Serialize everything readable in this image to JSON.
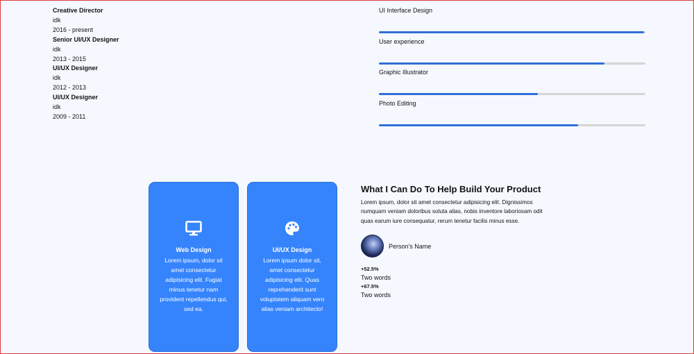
{
  "experience": [
    {
      "role": "Creative Director",
      "company": "idk",
      "period": "2016 - present"
    },
    {
      "role": "Senior UI/UX Designer",
      "company": "idk",
      "period": "2013 - 2015"
    },
    {
      "role": "UI/UX Designer",
      "company": "idk",
      "period": "2012 - 2013"
    },
    {
      "role": "UI/UX Designer",
      "company": "idk",
      "period": "2009 - 2011"
    }
  ],
  "skills": [
    {
      "name": "UI Interface Design",
      "percent": 100
    },
    {
      "name": "User experience",
      "percent": 85
    },
    {
      "name": "Graphic Illustrator",
      "percent": 60
    },
    {
      "name": "Photo Editing",
      "percent": 75
    }
  ],
  "services": [
    {
      "icon": "monitor-icon",
      "title": "Web Design",
      "description": "Lorem ipsum, dolor sit amet consectetur adipisicing elit. Fugiat minus tenetur nam provident repellendus qui, sed ea."
    },
    {
      "icon": "palette-icon",
      "title": "UI/UX Design",
      "description": "Lorem ipsum dolor sit, amet consectetur adipisicing elit. Quas reprehenderit sunt voluptatem aliquam vero alias veniam architecto!"
    }
  ],
  "about": {
    "heading": "What I Can Do To Help Build Your Product",
    "paragraph": "Lorem ipsum, dolor sit amet consectetur adipisicing elit. Dignissimos numquam veniam doloribus soluta alias, nobis inventore laboriosam odit quas earum iure consequatur, rerum tenetur facilis minus esse.",
    "person_name": "Person's Name",
    "stats": [
      {
        "value": "+52.5%",
        "label": "Two words"
      },
      {
        "value": "+67.5%",
        "label": "Two words"
      }
    ]
  },
  "colors": {
    "accent": "#3584fc",
    "bar": "#2f6fd6",
    "background": "#f5f9ff"
  }
}
